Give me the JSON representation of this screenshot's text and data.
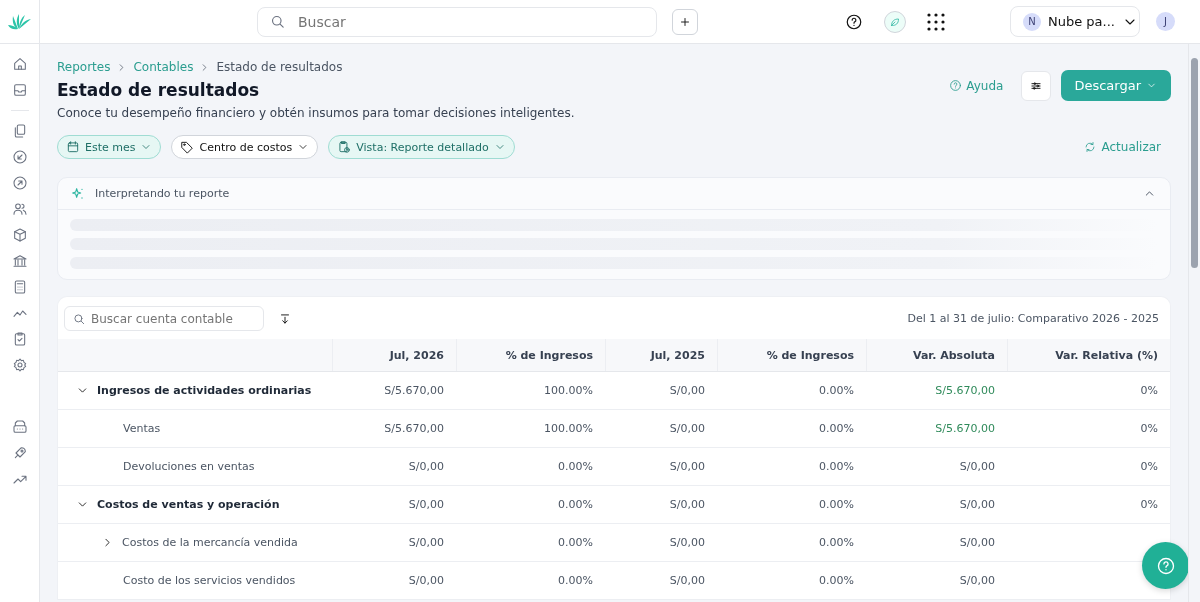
{
  "topbar": {
    "search": {
      "placeholder": "Buscar"
    },
    "account": {
      "initial": "N",
      "name": "Nube pa..."
    },
    "user_initial": "J"
  },
  "breadcrumb": [
    {
      "label": "Reportes",
      "link": true
    },
    {
      "label": "Contables",
      "link": true
    },
    {
      "label": "Estado de resultados",
      "link": false
    }
  ],
  "title": "Estado de resultados",
  "subtitle": "Conoce tu desempeño financiero y obtén insumos para tomar decisiones inteligentes.",
  "actions": {
    "help": "Ayuda",
    "download": "Descargar"
  },
  "filters": [
    {
      "label": "Este mes",
      "kind": "period",
      "active": true
    },
    {
      "label": "Centro de costos",
      "kind": "cost_center",
      "active": false
    },
    {
      "label": "Vista: Reporte detallado",
      "kind": "view",
      "active": true
    }
  ],
  "refresh": "Actualizar",
  "insight": {
    "title": "Interpretando tu reporte",
    "expanded": true,
    "loading": true
  },
  "table": {
    "search": {
      "placeholder": "Buscar cuenta contable"
    },
    "period": "Del 1 al 31 de julio: Comparativo 2026 - 2025",
    "columns": [
      "Jul, 2026",
      "% de Ingresos",
      "Jul, 2025",
      "% de Ingresos",
      "Var. Absoluta",
      "Var. Relativa (%)"
    ],
    "rows": [
      {
        "label": "Ingresos de actividades ordinarias",
        "expanded": true,
        "gain": true,
        "cells": [
          "S/5.670,00",
          "100.00%",
          "S/0,00",
          "0.00%",
          "S/5.670,00",
          "0%"
        ],
        "children": [
          {
            "label": "Ventas",
            "gain": true,
            "cells": [
              "S/5.670,00",
              "100.00%",
              "S/0,00",
              "0.00%",
              "S/5.670,00",
              "0%"
            ]
          },
          {
            "label": "Devoluciones en ventas",
            "gain": false,
            "cells": [
              "S/0,00",
              "0.00%",
              "S/0,00",
              "0.00%",
              "S/0,00",
              "0%"
            ]
          }
        ]
      },
      {
        "label": "Costos de ventas y operación",
        "expanded": true,
        "gain": false,
        "cells": [
          "S/0,00",
          "0.00%",
          "S/0,00",
          "0.00%",
          "S/0,00",
          "0%"
        ],
        "children": [
          {
            "label": "Costos de la mercancía vendida",
            "expanded": false,
            "gain": false,
            "cells": [
              "S/0,00",
              "0.00%",
              "S/0,00",
              "0.00%",
              "S/0,00"
            ]
          },
          {
            "label": "Costo de los servicios vendidos",
            "gain": false,
            "cells": [
              "S/0,00",
              "0.00%",
              "S/0,00",
              "0.00%",
              "S/0,00"
            ]
          }
        ]
      }
    ]
  }
}
